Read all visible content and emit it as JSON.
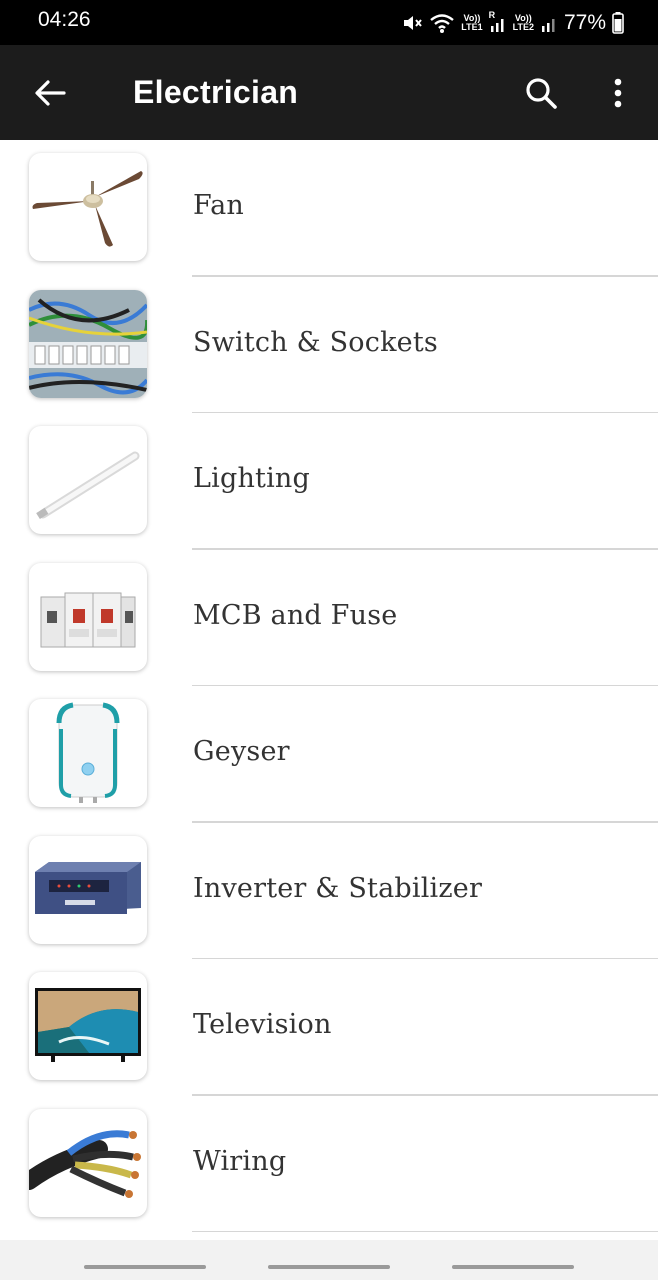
{
  "status_bar": {
    "time": "04:26",
    "sim1_label_top": "Vo))",
    "sim1_label_bottom": "LTE1",
    "sim2_label_top": "Vo))",
    "sim2_label_bottom": "LTE2",
    "roaming": "R",
    "battery": "77%"
  },
  "app_bar": {
    "title": "Electrician",
    "back_icon": "arrow-back-icon",
    "search_icon": "search-icon",
    "more_icon": "more-vert-icon",
    "background": "#1c1c1c"
  },
  "categories": [
    {
      "label": "Fan",
      "icon": "fan-image"
    },
    {
      "label": "Switch & Sockets",
      "icon": "switchboard-image"
    },
    {
      "label": "Lighting",
      "icon": "tube-light-image"
    },
    {
      "label": "MCB and Fuse",
      "icon": "mcb-image"
    },
    {
      "label": "Geyser",
      "icon": "geyser-image"
    },
    {
      "label": "Inverter & Stabilizer",
      "icon": "inverter-image"
    },
    {
      "label": "Television",
      "icon": "television-image"
    },
    {
      "label": "Wiring",
      "icon": "wiring-image"
    }
  ]
}
